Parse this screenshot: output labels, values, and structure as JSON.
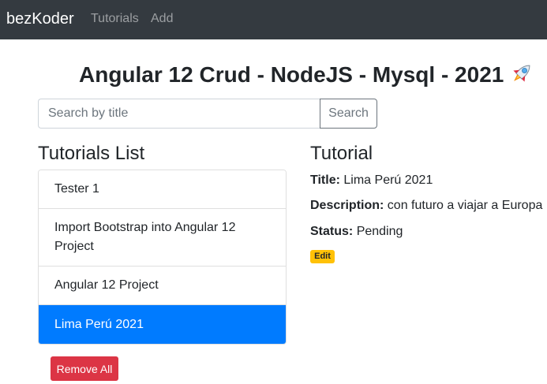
{
  "navbar": {
    "brand": "bezKoder",
    "links": [
      {
        "label": "Tutorials"
      },
      {
        "label": "Add"
      }
    ]
  },
  "page_title": "Angular 12 Crud - NodeJS - Mysql - 2021",
  "title_icon": "rocket-icon",
  "search": {
    "placeholder": "Search by title",
    "value": "",
    "button_label": "Search"
  },
  "tutorials_list": {
    "heading": "Tutorials List",
    "items": [
      {
        "label": "Tester 1"
      },
      {
        "label": "Import Bootstrap into Angular 12 Project"
      },
      {
        "label": "Angular 12 Project"
      },
      {
        "label": "Lima Perú 2021",
        "selected": true
      }
    ],
    "remove_all_label": "Remove All"
  },
  "tutorial_detail": {
    "heading": "Tutorial",
    "title_label": "Title:",
    "title_value": "Lima Perú 2021",
    "description_label": "Description:",
    "description_value": "con futuro a viajar a Europa",
    "status_label": "Status:",
    "status_value": "Pending",
    "edit_label": "Edit"
  },
  "colors": {
    "navbar_bg": "#343a40",
    "active_item": "#007bff",
    "danger": "#dc3545",
    "warning": "#ffc107"
  }
}
